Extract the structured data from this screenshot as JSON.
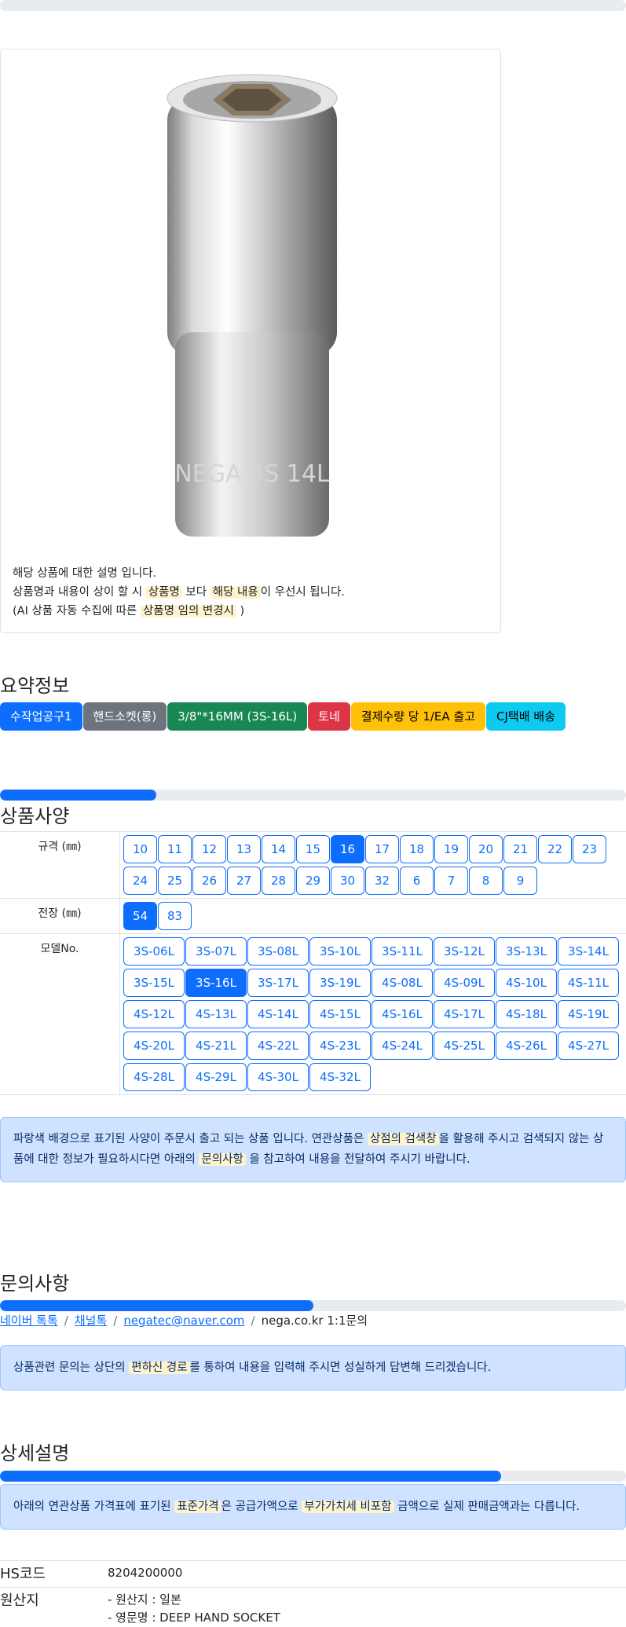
{
  "notice": {
    "line1": "해당 상품에 대한 설명 입니다.",
    "line2_a": "상품명과 내용이 상이 할 시 ",
    "line2_hl1": "상품명",
    "line2_b": " 보다 ",
    "line2_hl2": "해당 내용",
    "line2_c": "이 우선시 됩니다.",
    "line3_a": "(AI 상품 자동 수집에 따른 ",
    "line3_hl": "상품명 임의 변경시",
    "line3_b": " )"
  },
  "product_image": {
    "engraving": "NEGA 3S 14L"
  },
  "summary": {
    "title": "요약정보",
    "badges": [
      {
        "label": "수작업공구1",
        "color": "#0d6efd"
      },
      {
        "label": "핸드소켓(롱)",
        "color": "#6c757d"
      },
      {
        "label": "3/8\"*16MM (3S-16L)",
        "color": "#198754"
      },
      {
        "label": "토네",
        "color": "#dc3545"
      },
      {
        "label": "결제수량 당 1/EA 출고",
        "color": "#ffc107"
      },
      {
        "label": "CJ택배 배송",
        "color": "#0dcaf0"
      }
    ]
  },
  "spec": {
    "progress_percent": 25,
    "title": "상품사양",
    "rows": [
      {
        "label": "규격 (㎜)",
        "options": [
          "10",
          "11",
          "12",
          "13",
          "14",
          "15",
          "16",
          "17",
          "18",
          "19",
          "20",
          "21",
          "22",
          "23",
          "24",
          "25",
          "26",
          "27",
          "28",
          "29",
          "30",
          "32",
          "6",
          "7",
          "8",
          "9"
        ],
        "selected": "16"
      },
      {
        "label": "전장 (㎜)",
        "options": [
          "54",
          "83"
        ],
        "selected": "54"
      },
      {
        "label": "모델No.",
        "options": [
          "3S-06L",
          "3S-07L",
          "3S-08L",
          "3S-10L",
          "3S-11L",
          "3S-12L",
          "3S-13L",
          "3S-14L",
          "3S-15L",
          "3S-16L",
          "3S-17L",
          "3S-19L",
          "4S-08L",
          "4S-09L",
          "4S-10L",
          "4S-11L",
          "4S-12L",
          "4S-13L",
          "4S-14L",
          "4S-15L",
          "4S-16L",
          "4S-17L",
          "4S-18L",
          "4S-19L",
          "4S-20L",
          "4S-21L",
          "4S-22L",
          "4S-23L",
          "4S-24L",
          "4S-25L",
          "4S-26L",
          "4S-27L",
          "4S-28L",
          "4S-29L",
          "4S-30L",
          "4S-32L"
        ],
        "selected": "3S-16L"
      }
    ],
    "alert_a": "파랑색 배경으로 표기된 사양이 주문시 출고 되는 상품 입니다. 연관상품은 ",
    "alert_hl1": "상점의 검색창",
    "alert_b": "을 활용해 주시고 검색되지 않는 상품에 대한 정보가 필요하시다면 아래의 ",
    "alert_hl2": "문의사항",
    "alert_c": " 을 참고하여 내용을 전달하여 주시기 바랍니다."
  },
  "inquiry": {
    "title": "문의사항",
    "progress_percent": 50,
    "links": [
      "네이버 톡톡",
      "채널톡",
      "negatec@naver.com"
    ],
    "plain": "nega.co.kr 1:1문의",
    "alert_a": "상품관련 문의는 상단의 ",
    "alert_hl": "편하신 경로",
    "alert_b": "를 통하여 내용을 입력해 주시면 성실하게 답변해 드리겠습니다."
  },
  "detail": {
    "title": "상세설명",
    "progress_percent": 80,
    "alert_a": "아래의 연관상품 가격표에 표기된 ",
    "alert_hl1": "표준가격",
    "alert_b": "은 공급가액으로 ",
    "alert_hl2": "부가가치세 비포함",
    "alert_c": " 금액으로 실제 판매금액과는 다릅니다.",
    "hs_label": "HS코드",
    "hs_value": "8204200000",
    "origin_label": "원산지",
    "origin_line1": "- 원산지 : 일본",
    "origin_line2": "- 영문명 : DEEP HAND SOCKET"
  }
}
